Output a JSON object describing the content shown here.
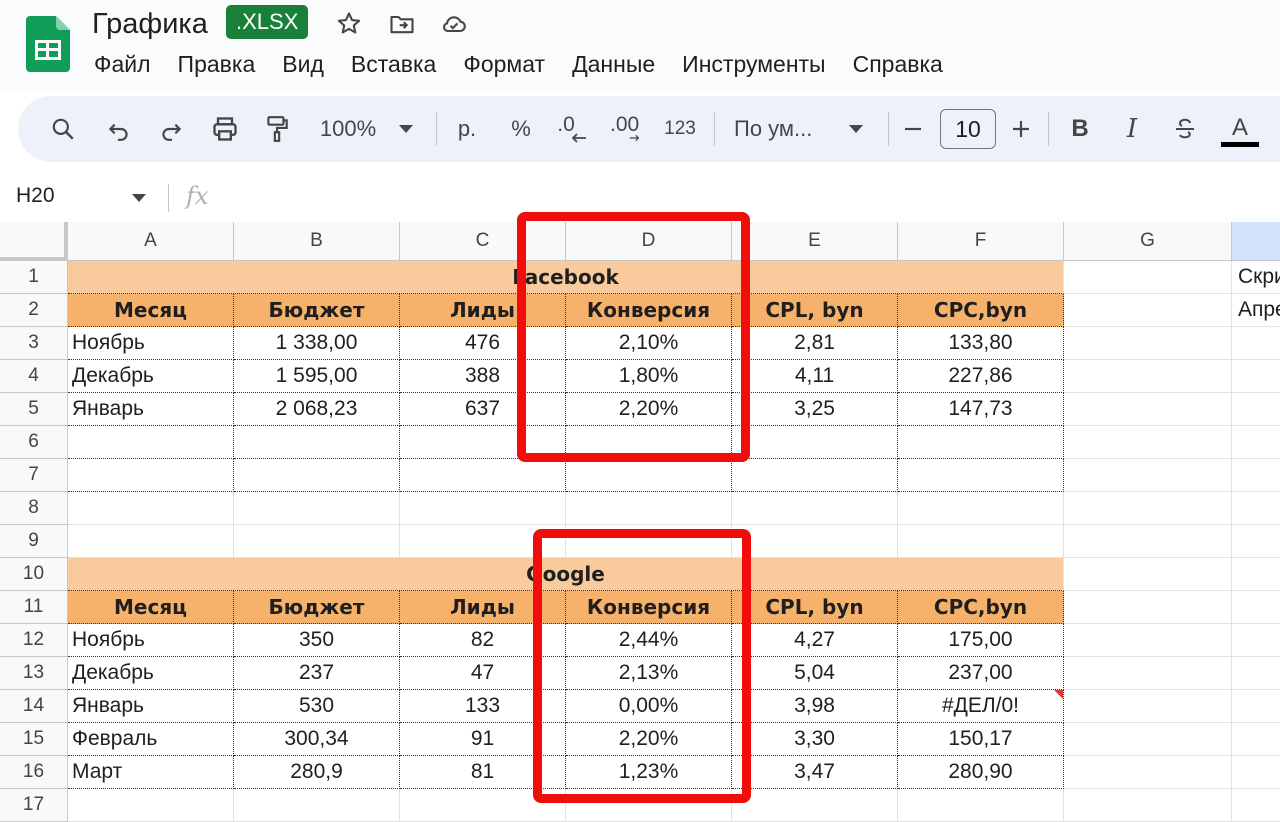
{
  "app": {
    "title": "Графика",
    "badge": ".XLSX",
    "accent_color": "#188038"
  },
  "menu": [
    "Файл",
    "Правка",
    "Вид",
    "Вставка",
    "Формат",
    "Данные",
    "Инструменты",
    "Справка"
  ],
  "toolbar": {
    "zoom": "100%",
    "currency": "р.",
    "percent": "%",
    "decrease_decimals": ".0",
    "increase_decimals": ".00",
    "number_format": "123",
    "font": "По ум...",
    "font_size": "10",
    "bold": "B",
    "italic": "I",
    "text_color": "A"
  },
  "formula_bar": {
    "cell_ref": "H20",
    "fx": "fx"
  },
  "columns": [
    "A",
    "B",
    "C",
    "D",
    "E",
    "F",
    "G"
  ],
  "rows": [
    "1",
    "2",
    "3",
    "4",
    "5",
    "6",
    "7",
    "8",
    "9",
    "10",
    "11",
    "12",
    "13",
    "14",
    "15",
    "16",
    "17"
  ],
  "facebook": {
    "title": "Facebook",
    "headers": [
      "Месяц",
      "Бюджет",
      "Лиды",
      "Конверсия",
      "CPL, byn",
      "CPC,byn"
    ],
    "data": [
      [
        "Ноябрь",
        "1 338,00",
        "476",
        "2,10%",
        "2,81",
        "133,80"
      ],
      [
        "Декабрь",
        "1 595,00",
        "388",
        "1,80%",
        "4,11",
        "227,86"
      ],
      [
        "Январь",
        "2 068,23",
        "637",
        "2,20%",
        "3,25",
        "147,73"
      ]
    ]
  },
  "google": {
    "title": "Google",
    "headers": [
      "Месяц",
      "Бюджет",
      "Лиды",
      "Конверсия",
      "CPL, byn",
      "CPC,byn"
    ],
    "data": [
      [
        "Ноябрь",
        "350",
        "82",
        "2,44%",
        "4,27",
        "175,00"
      ],
      [
        "Декабрь",
        "237",
        "47",
        "2,13%",
        "5,04",
        "237,00"
      ],
      [
        "Январь",
        "530",
        "133",
        "0,00%",
        "3,98",
        "#ДЕЛ/0!"
      ],
      [
        "Февраль",
        "300,34",
        "91",
        "2,20%",
        "3,30",
        "150,17"
      ],
      [
        "Март",
        "280,9",
        "81",
        "1,23%",
        "3,47",
        "280,90"
      ]
    ]
  },
  "side_text": [
    "Скри",
    "Апре"
  ],
  "highlight_color": "#f20d0d"
}
